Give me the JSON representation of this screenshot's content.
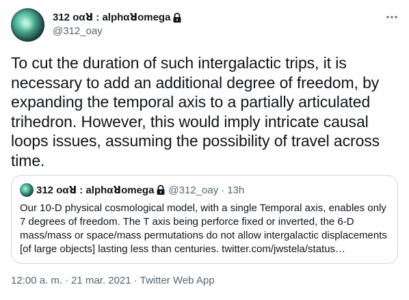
{
  "author": {
    "display_name": "312 οαꓤ : alphαꓤomega",
    "handle": "@312_oay",
    "protected": true
  },
  "tweet": {
    "text": "To cut the duration of such intergalactic trips, it is necessary to add an additional degree of freedom, by expanding the temporal axis to a partially articulated trihedron. However, this would imply intricate causal loops issues, assuming the possibility of travel across time."
  },
  "quoted": {
    "display_name": "312 οαꓤ : alphαꓤomega",
    "handle": "@312_oay",
    "separator": "·",
    "time": "13h",
    "text": "Our 10-D physical cosmological model, with a single Temporal axis, enables only 7 degrees of freedom. The T axis being perforce fixed or inverted, the 6-D mass/mass or space/mass permutations do not allow intergalactic displacements [of large objects] lasting less than centuries. twitter.com/jwstela/status…"
  },
  "meta": {
    "time": "12:00 a. m.",
    "separator": "·",
    "date": "21 mar. 2021",
    "source": "Twitter Web App"
  },
  "icons": {
    "more": "more-horizontal-icon",
    "lock": "lock-icon",
    "avatar": "avatar"
  },
  "colors": {
    "text": "#0f1419",
    "secondary": "#536471",
    "border": "#cfd9de"
  }
}
